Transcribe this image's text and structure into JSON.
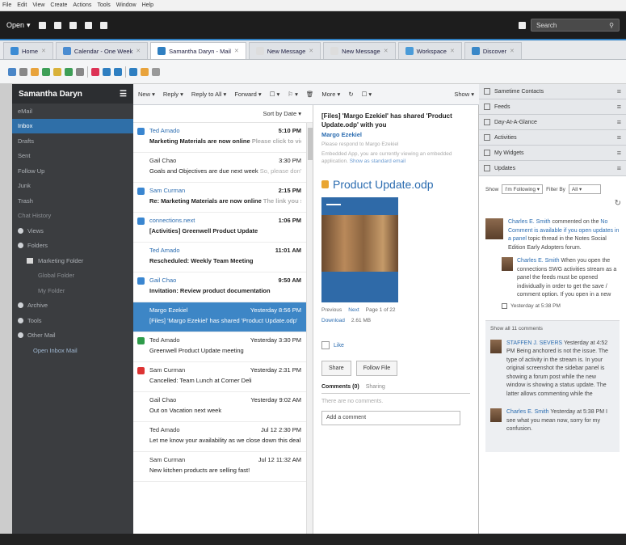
{
  "menubar": [
    "File",
    "Edit",
    "View",
    "Create",
    "Actions",
    "Tools",
    "Window",
    "Help"
  ],
  "topbar": {
    "open_label": "Open",
    "search_placeholder": "Search"
  },
  "tabs": [
    {
      "label": "Home",
      "color": "#3b8bd4"
    },
    {
      "label": "Calendar - One Week",
      "color": "#4a8cd1"
    },
    {
      "label": "Samantha Daryn - Mail",
      "color": "#2f7fc1",
      "active": true
    },
    {
      "label": "New Message",
      "color": "#ddd"
    },
    {
      "label": "New Message",
      "color": "#ddd"
    },
    {
      "label": "Workspace",
      "color": "#4a9bd8"
    },
    {
      "label": "Discover",
      "color": "#3a88c8"
    }
  ],
  "sidebar": {
    "title": "Samantha Daryn",
    "items": [
      {
        "label": "eMail",
        "cls": ""
      },
      {
        "label": "Inbox",
        "cls": "sel"
      },
      {
        "label": "Drafts",
        "cls": ""
      },
      {
        "label": "Sent",
        "cls": ""
      },
      {
        "label": "Follow Up",
        "cls": ""
      },
      {
        "label": "Junk",
        "cls": ""
      },
      {
        "label": "Trash",
        "cls": ""
      },
      {
        "label": "Chat History",
        "cls": "dim"
      },
      {
        "label": "Views",
        "cls": "",
        "bullet": true
      },
      {
        "label": "Folders",
        "cls": "",
        "bullet": true
      },
      {
        "label": "Marketing Folder",
        "cls": "indent",
        "folder": true
      },
      {
        "label": "Global Folder",
        "cls": "indent2 dim"
      },
      {
        "label": "My Folder",
        "cls": "indent2 dim"
      },
      {
        "label": "Archive",
        "cls": "",
        "bullet": true
      },
      {
        "label": "Tools",
        "cls": "",
        "bullet": true
      },
      {
        "label": "Other Mail",
        "cls": "",
        "bullet": true
      },
      {
        "label": "Open Inbox Mail",
        "cls": "link"
      }
    ]
  },
  "mailbar": {
    "new": "New",
    "reply": "Reply",
    "reply_all": "Reply to All",
    "forward": "Forward",
    "more": "More",
    "show": "Show"
  },
  "list": {
    "sort_label": "Sort by Date",
    "messages": [
      {
        "from": "Ted Amado",
        "time": "5:10 PM",
        "subject": "Marketing Materials are now online",
        "snippet": "Please click to view.",
        "state": "unread",
        "mark": "#3a86d0"
      },
      {
        "from": "Gail Chao",
        "time": "3:30 PM",
        "subject": "Goals and Objectives are due next week",
        "snippet": "So, please don't leave",
        "state": "read",
        "mark": ""
      },
      {
        "from": "Sam Curman",
        "time": "2:15 PM",
        "subject": "Re: Marketing Materials are now online",
        "snippet": "The link you sent me",
        "state": "unread",
        "mark": "#3a86d0"
      },
      {
        "from": "connections.next",
        "time": "1:06 PM",
        "subject": "[Activities] Greenwell Product Update",
        "snippet": "",
        "state": "unread",
        "mark": "#3a86d0"
      },
      {
        "from": "Ted Amado",
        "time": "11:01 AM",
        "subject": "Rescheduled: Weekly Team Meeting",
        "snippet": "",
        "state": "unread",
        "mark": ""
      },
      {
        "from": "Gail Chao",
        "time": "9:50 AM",
        "subject": "Invitation: Review product documentation",
        "snippet": "",
        "state": "unread",
        "mark": "#3a86d0"
      },
      {
        "from": "Margo Ezekiel",
        "time": "Yesterday 8:56 PM",
        "subject": "[Files] 'Margo Ezekiel' has shared 'Product Update.odp'",
        "snippet": "",
        "state": "sel",
        "mark": ""
      },
      {
        "from": "Ted Amado",
        "time": "Yesterday 3:30 PM",
        "subject": "Greenwell Product Update meeting",
        "snippet": "",
        "state": "read",
        "mark": "#2e9b4a"
      },
      {
        "from": "Sam Curman",
        "time": "Yesterday 2:31 PM",
        "subject": "Cancelled: Team Lunch at Corner Deli",
        "snippet": "",
        "state": "read",
        "mark": "#d33"
      },
      {
        "from": "Gail Chao",
        "time": "Yesterday 9:02 AM",
        "subject": "Out on Vacation next week",
        "snippet": "",
        "state": "read",
        "mark": ""
      },
      {
        "from": "Ted Amado",
        "time": "Jul 12 2:30 PM",
        "subject": "Let me know your availability as we close down this deal",
        "snippet": "",
        "state": "read",
        "mark": ""
      },
      {
        "from": "Sam Curman",
        "time": "Jul 12 11:32 AM",
        "subject": "New kitchen products are selling fast!",
        "snippet": "",
        "state": "read",
        "mark": ""
      }
    ]
  },
  "reading": {
    "subject": "[Files] 'Margo Ezekiel' has shared 'Product Update.odp' with you",
    "from": "Margo Ezekiel",
    "note1": "Please respond to Margo Ezekiel",
    "note2": "Embedded App, you are currently viewing an embedded application.",
    "note_link": "Show as standard email",
    "file_title": "Product Update.odp",
    "previous": "Previous",
    "next": "Next",
    "page": "Page 1 of 22",
    "download": "Download",
    "size": "2.61 MB",
    "like": "Like",
    "share": "Share",
    "follow": "Follow File",
    "comments_tab": "Comments (0)",
    "sharing_tab": "Sharing",
    "no_comments": "There are no comments.",
    "add_comment": "Add a comment"
  },
  "rpane": {
    "rows": [
      "Sametime Contacts",
      "Feeds",
      "Day-At-A-Glance",
      "Activities",
      "My Widgets",
      "Updates"
    ],
    "show_label": "Show",
    "show_value": "I'm Following",
    "filter_label": "Filter By",
    "filter_value": "All",
    "update1": "commented on the",
    "update1_name": "Charles E. Smith",
    "update1_link": "No Comment is available if you open updates in a panel",
    "update1_tail": "topic thread in the Notes Social Edition Early Adopters forum.",
    "reply1_name": "Charles E. Smith",
    "reply1_text": "When you open the connections SWG activities stream as a panel the feeds must be opened individually in order to get the save / comment option. If you open in a new",
    "reply1_time": "Yesterday at 5:38 PM",
    "show_all": "Show all 11 comments",
    "c1_name": "STAFFEN J. SEVERS",
    "c1_time": "Yesterday at 4:52 PM",
    "c1_text": "Being anchored is not the issue. The type of activity in the stream is. In your original screenshot the sidebar panel is showing a forum post while the new window is showing a status update. The latter allows commenting while the",
    "c2_name": "Charles E. Smith",
    "c2_time": "Yesterday at 5:38 PM",
    "c2_text": "I see what you mean now, sorry for my confusion."
  }
}
